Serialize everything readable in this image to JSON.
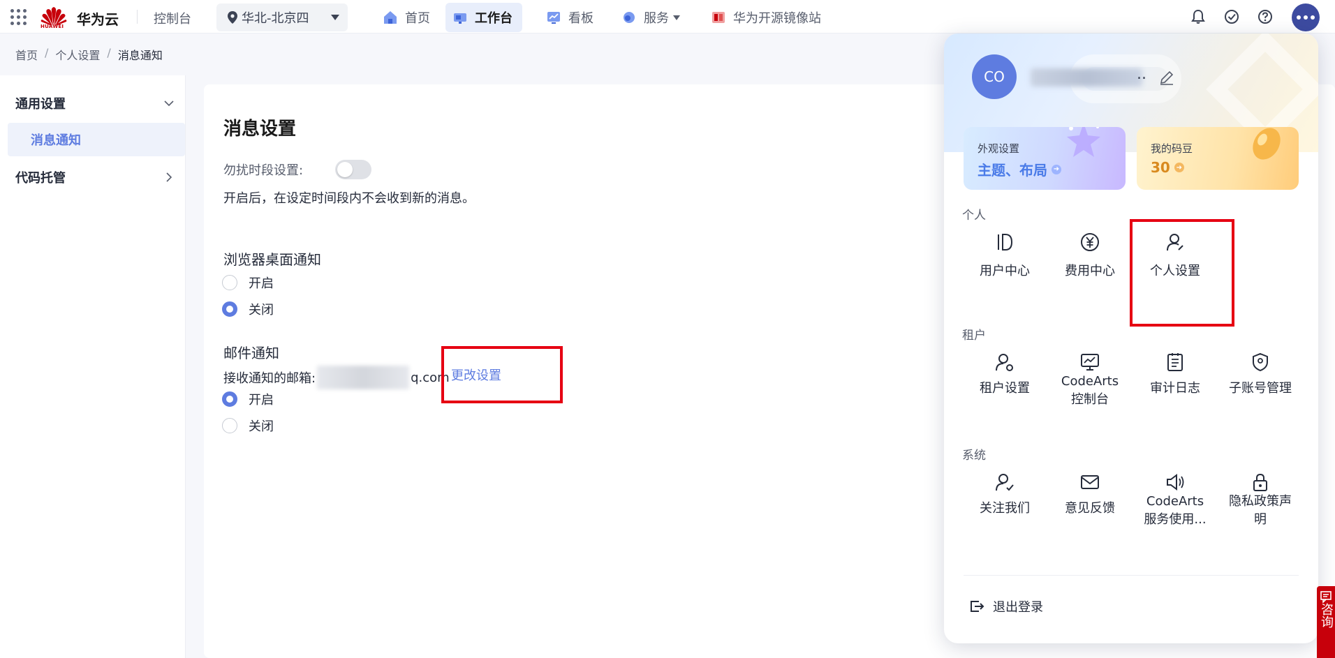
{
  "topbar": {
    "brand": "华为云",
    "logo_text": "HUAWEI",
    "console": "控制台",
    "region": "华北-北京四",
    "nav": {
      "home": "首页",
      "workbench": "工作台",
      "board": "看板",
      "service": "服务",
      "mirror": "华为开源镜像站"
    },
    "icons": [
      "bell-icon",
      "check-circle-icon",
      "help-icon",
      "more-icon"
    ]
  },
  "breadcrumb": {
    "home": "首页",
    "personal": "个人设置",
    "current": "消息通知",
    "sep": "/"
  },
  "sidebar": {
    "group_general": "通用设置",
    "item_message": "消息通知",
    "group_code": "代码托管"
  },
  "main": {
    "title": "消息设置",
    "dnd_label": "勿扰时段设置:",
    "dnd_desc": "开启后，在设定时间段内不会收到新的消息。",
    "browser_title": "浏览器桌面通知",
    "browser_on": "开启",
    "browser_off": "关闭",
    "email_title": "邮件通知",
    "email_prefix": "接收通知的邮箱:",
    "email_suffix": "q.com",
    "change_link": "更改设置",
    "email_on": "开启",
    "email_off": "关闭"
  },
  "panel": {
    "avatar_initials": "CO",
    "name_ellipsis": "..",
    "card_look_label": "外观设置",
    "card_look_value": "主题、布局",
    "card_bean_label": "我的码豆",
    "card_bean_value": "30",
    "section_personal": "个人",
    "personal_items": [
      "用户中心",
      "费用中心",
      "个人设置"
    ],
    "section_tenant": "租户",
    "tenant_items": [
      "租户设置",
      "CodeArts\n控制台",
      "审计日志",
      "子账号管理"
    ],
    "section_system": "系统",
    "system_items": [
      "关注我们",
      "意见反馈",
      "CodeArts\n服务使用...",
      "隐私政策声\n明"
    ],
    "logout": "退出登录"
  },
  "consult": "咨询",
  "colors": {
    "accent": "#5e7ce0",
    "brand_red": "#c7000b",
    "highlight_box": "#e60012"
  }
}
